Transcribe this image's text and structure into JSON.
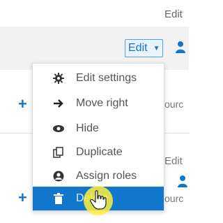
{
  "header": {
    "edit_top": "Edit",
    "edit_dropdown": "Edit",
    "edit_bottom": "Edit"
  },
  "rows": {
    "partial_text_1": "ourc",
    "partial_text_2": "ourc"
  },
  "menu": {
    "items": [
      {
        "label": "Edit settings",
        "icon": "gear-icon"
      },
      {
        "label": "Move right",
        "icon": "arrow-right-icon"
      },
      {
        "label": "Hide",
        "icon": "eye-icon"
      },
      {
        "label": "Duplicate",
        "icon": "duplicate-icon"
      },
      {
        "label": "Assign roles",
        "icon": "user-circle-icon"
      },
      {
        "label": "Delete",
        "icon": "trash-icon",
        "highlighted": true
      }
    ]
  },
  "colors": {
    "accent": "#1177cc",
    "highlight": "#1177cc",
    "cursor_halo": "#ffee3c"
  }
}
